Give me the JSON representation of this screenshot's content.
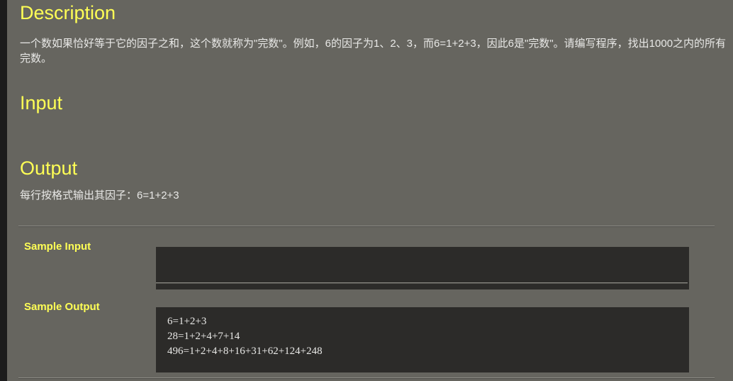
{
  "theme": {
    "page_background": "#66655f",
    "heading_color": "#ffff55",
    "body_text_color": "#e8e8e6",
    "code_background": "#2c2b29",
    "edge_strip_color": "#1c1c1c"
  },
  "sections": {
    "description": {
      "heading": "Description",
      "text": "一个数如果恰好等于它的因子之和，这个数就称为\"完数\"。例如，6的因子为1、2、3，而6=1+2+3，因此6是\"完数\"。请编写程序，找出1000之内的所有完数。"
    },
    "input": {
      "heading": "Input",
      "text": ""
    },
    "output": {
      "heading": "Output",
      "text": "每行按格式输出其因子：6=1+2+3"
    }
  },
  "samples": {
    "input": {
      "label": "Sample Input",
      "content": ""
    },
    "output": {
      "label": "Sample Output",
      "content": "6=1+2+3\n28=1+2+4+7+14\n496=1+2+4+8+16+31+62+124+248"
    }
  }
}
